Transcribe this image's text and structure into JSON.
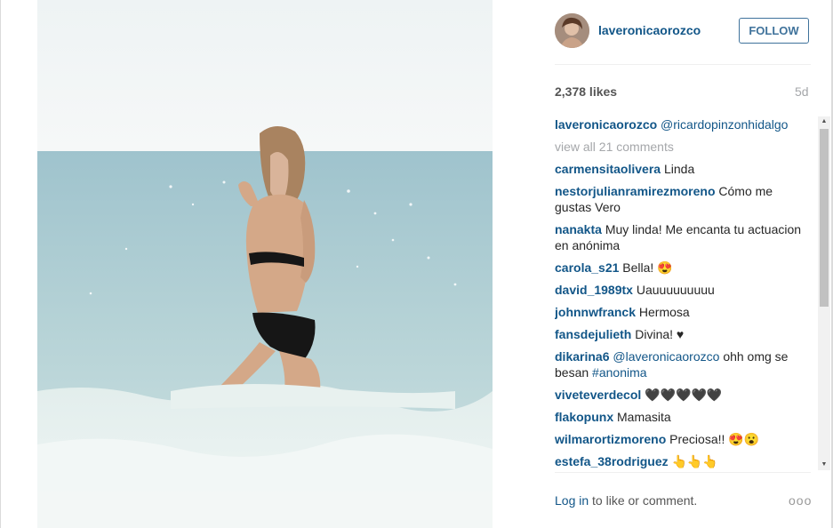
{
  "post": {
    "username": "laveronicaorozco",
    "follow_label": "FOLLOW",
    "likes": "2,378 likes",
    "age": "5d",
    "caption": {
      "user": "laveronicaorozco",
      "text": "@ricardopinzonhidalgo"
    },
    "view_all": "view all 21 comments",
    "comments": [
      {
        "user": "carmensitaolivera",
        "text": "Linda"
      },
      {
        "user": "nestorjulianramirezmoreno",
        "text": "Cómo me gustas Vero"
      },
      {
        "user": "nanakta",
        "text": "Muy linda! Me encanta tu actuacion en anónima"
      },
      {
        "user": "carola_s21",
        "text": "Bella! 😍"
      },
      {
        "user": "david_1989tx",
        "text": "Uauuuuuuuuu"
      },
      {
        "user": "johnnwfranck",
        "text": "Hermosa"
      },
      {
        "user": "fansdejulieth",
        "text": "Divina! ♥"
      },
      {
        "user": "dikarina6",
        "mention": "@laveronicaorozco",
        "text": "ohh omg se besan",
        "hashtag": "#anonima"
      },
      {
        "user": "viveteverdecol",
        "text": "🖤🖤🖤🖤🖤"
      },
      {
        "user": "flakopunx",
        "text": "Mamasita"
      },
      {
        "user": "wilmarortizmoreno",
        "text": "Preciosa!! 😍😮"
      },
      {
        "user": "estefa_38rodriguez",
        "text": "👆👆👆"
      }
    ],
    "login_link": "Log in",
    "login_rest": " to like or comment.",
    "more_label": "ooo"
  },
  "icons": {
    "more": "more-options-icon",
    "scroll_up": "scroll-up-arrow-icon",
    "scroll_down": "scroll-down-arrow-icon"
  },
  "colors": {
    "username_blue": "#125688",
    "follow_border": "#3f729b",
    "muted_gray": "#a5a7aa"
  }
}
